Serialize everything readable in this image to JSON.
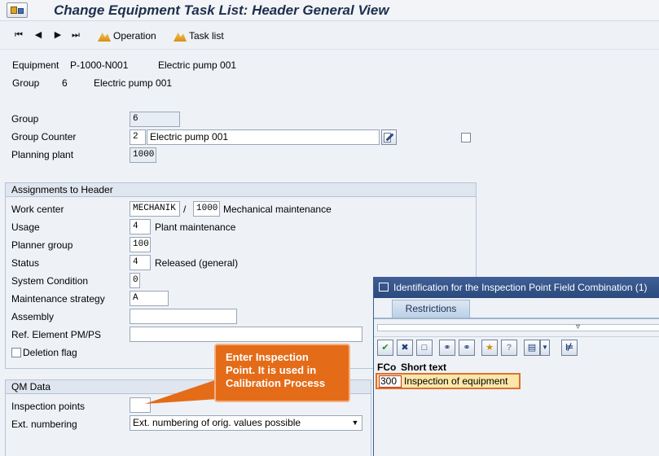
{
  "title": "Change Equipment Task List: Header General View",
  "toolbar": {
    "operation_label": "Operation",
    "task_list_label": "Task list"
  },
  "header_info": {
    "equipment_label": "Equipment",
    "equipment_value": "P-1000-N001",
    "equipment_desc": "Electric pump 001",
    "group_label": "Group",
    "group_value": "6",
    "group_desc": "Electric pump 001"
  },
  "general": {
    "group_label": "Group",
    "group_value": "6",
    "group_counter_label": "Group Counter",
    "group_counter_value": "2",
    "group_counter_text": "Electric pump 001",
    "planning_plant_label": "Planning plant",
    "planning_plant_value": "1000"
  },
  "assignments": {
    "section_title": "Assignments to Header",
    "work_center_label": "Work center",
    "work_center_value": "MECHANIK",
    "work_center_sep": "/",
    "work_center_plant": "1000",
    "work_center_desc": "Mechanical maintenance",
    "usage_label": "Usage",
    "usage_value": "4",
    "usage_desc": "Plant maintenance",
    "planner_group_label": "Planner group",
    "planner_group_value": "100",
    "status_label": "Status",
    "status_value": "4",
    "status_desc": "Released (general)",
    "system_condition_label": "System Condition",
    "system_condition_value": "0",
    "maint_strategy_label": "Maintenance strategy",
    "maint_strategy_value": "A",
    "assembly_label": "Assembly",
    "assembly_value": "",
    "ref_element_label": "Ref. Element PM/PS",
    "ref_element_value": "",
    "deletion_flag_label": "Deletion flag"
  },
  "qm": {
    "section_title": "QM Data",
    "inspection_points_label": "Inspection points",
    "inspection_points_value": "",
    "ext_numbering_label": "Ext. numbering",
    "ext_numbering_value": "Ext. numbering of orig. values possible"
  },
  "popup": {
    "title": "Identification for the Inspection Point Field Combination (1)",
    "tab_label": "Restrictions",
    "col_fco": "FCo",
    "col_short_text": "Short text",
    "row_code": "300",
    "row_text": "Inspection of equipment"
  },
  "callout": {
    "line1": "Enter Inspection",
    "line2": "Point. It is used in",
    "line3": "Calibration Process"
  },
  "colors": {
    "callout": "#e46c18",
    "popup_title": "#2b4a7d",
    "highlight_row": "#fbe7a9"
  }
}
